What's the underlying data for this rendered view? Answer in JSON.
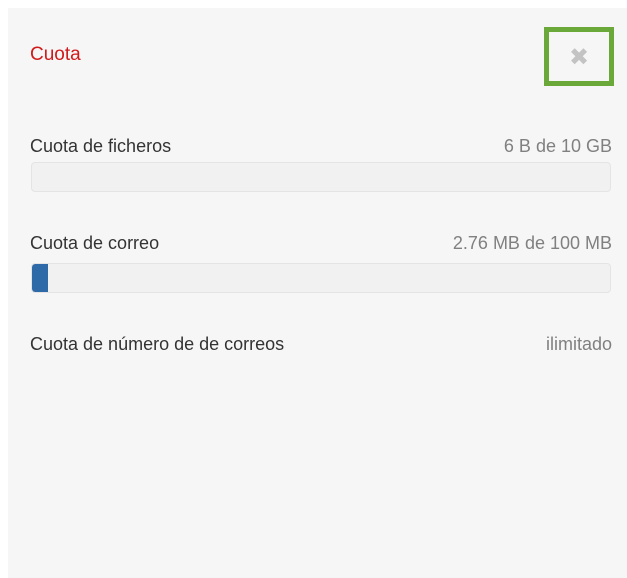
{
  "panel": {
    "title": "Cuota",
    "close_icon": "close-icon"
  },
  "quotas": [
    {
      "label": "Cuota de ficheros",
      "value": "6 B de 10 GB",
      "usage_fraction": 0.0
    },
    {
      "label": "Cuota de correo",
      "value": "2.76 MB de 100 MB",
      "usage_fraction": 0.0276
    },
    {
      "label": "Cuota de número de de correos",
      "value": "ilimitado"
    }
  ],
  "colors": {
    "title": "#d11a1a",
    "highlight_border": "#6aa83a",
    "bar_fill": "#2f6aa8"
  }
}
